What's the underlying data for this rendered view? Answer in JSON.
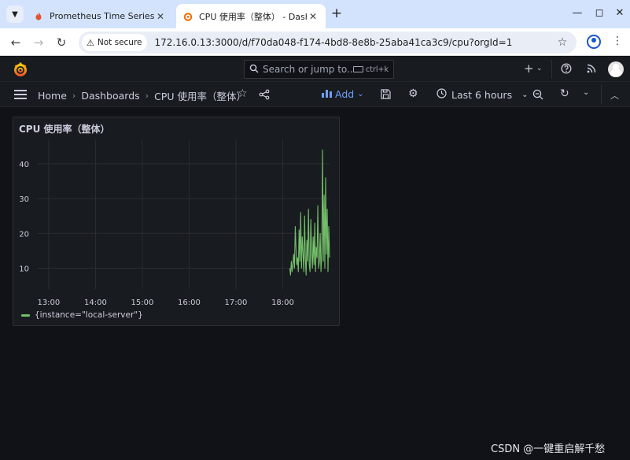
{
  "browser": {
    "tabs": [
      {
        "title": "Prometheus Time Series Col",
        "active": false
      },
      {
        "title": "CPU 使用率（整体） - Dashb",
        "active": true
      }
    ],
    "security_label": "Not secure",
    "url": "172.16.0.13:3000/d/f70da048-f174-4bd8-8e8b-25aba41ca3c9/cpu?orgId=1"
  },
  "grafana": {
    "search_placeholder": "Search or jump to...",
    "search_shortcut": "ctrl+k",
    "breadcrumbs": [
      "Home",
      "Dashboards",
      "CPU 使用率（整体）"
    ],
    "add_label": "Add",
    "time_range": "Last 6 hours"
  },
  "panel": {
    "title": "CPU 使用率（整体）"
  },
  "chart_data": {
    "type": "line",
    "title": "CPU 使用率（整体）",
    "xlabel": "",
    "ylabel": "",
    "x_ticks": [
      "13:00",
      "14:00",
      "15:00",
      "16:00",
      "17:00",
      "18:00"
    ],
    "y_ticks": [
      10,
      20,
      30,
      40
    ],
    "xlim": [
      "12:45",
      "19:00"
    ],
    "ylim": [
      4,
      47
    ],
    "grid": true,
    "legend_position": "bottom-left",
    "series": [
      {
        "name": "{instance=\"local-server\"}",
        "color": "#73bf69",
        "x": [
          "18:09",
          "18:10",
          "18:11",
          "18:12",
          "18:13",
          "18:14",
          "18:15",
          "18:16",
          "18:17",
          "18:18",
          "18:19",
          "18:20",
          "18:21",
          "18:22",
          "18:23",
          "18:24",
          "18:25",
          "18:26",
          "18:27",
          "18:28",
          "18:29",
          "18:30",
          "18:31",
          "18:32",
          "18:33",
          "18:34",
          "18:35",
          "18:36",
          "18:37",
          "18:38",
          "18:39",
          "18:40",
          "18:41",
          "18:42",
          "18:43",
          "18:44",
          "18:45",
          "18:46",
          "18:47",
          "18:48",
          "18:49",
          "18:50",
          "18:51",
          "18:52",
          "18:53",
          "18:54",
          "18:55",
          "18:56",
          "18:57",
          "18:58",
          "18:59",
          "19:00"
        ],
        "values": [
          10,
          8,
          12,
          9,
          11,
          14,
          10,
          22,
          16,
          11,
          13,
          9,
          21,
          12,
          26,
          10,
          19,
          14,
          9,
          25,
          13,
          8,
          18,
          12,
          27,
          11,
          9,
          24,
          15,
          10,
          19,
          11,
          23,
          9,
          16,
          13,
          28,
          10,
          12,
          20,
          9,
          14,
          44,
          12,
          31,
          10,
          36,
          14,
          27,
          9,
          22,
          13
        ]
      }
    ]
  },
  "watermark": "CSDN @一键重启解千愁"
}
